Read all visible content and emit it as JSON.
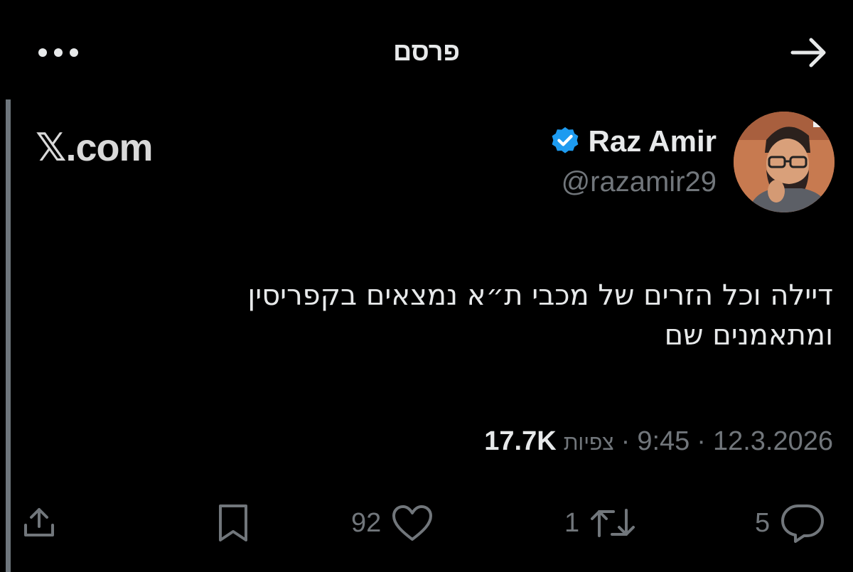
{
  "header": {
    "title": "פרסם",
    "more_icon": "more-horizontal-icon",
    "back_icon": "arrow-right-icon"
  },
  "quote": {
    "source": "𝕏.com",
    "author": {
      "name": "Raz Amir",
      "handle": "@razamir29",
      "verified": true,
      "verified_color": "#1d9bf0"
    },
    "text_line1": "דיילה וכל הזרים של מכבי ת״א נמצאים בקפריסין",
    "text_line2": "ומתאמנים שם",
    "date": "12.3.2026",
    "time": "9:45",
    "sep1": "·",
    "sep2": "·",
    "views_label": "צפיות",
    "views": "17.7K"
  },
  "actions": {
    "reply_count": "5",
    "retweet_count": "1",
    "like_count": "92"
  },
  "colors": {
    "background": "#000000",
    "text": "#e7e9ea",
    "muted": "#71767b",
    "accent": "#1d9bf0"
  }
}
